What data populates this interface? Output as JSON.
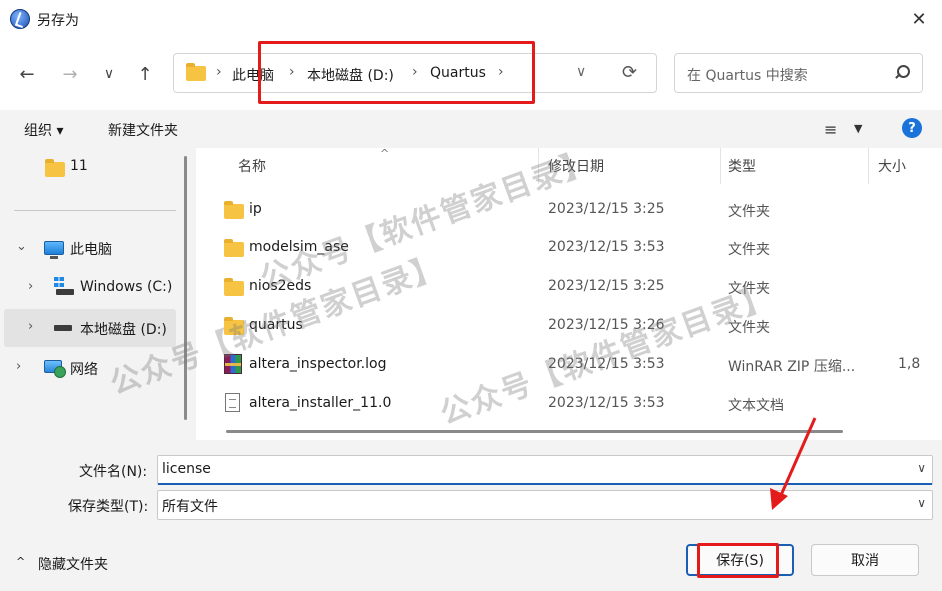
{
  "window": {
    "title": "另存为",
    "close_glyph": "✕"
  },
  "nav": {
    "back_glyph": "←",
    "forward_glyph": "→",
    "recent_glyph": "∨",
    "up_glyph": "↑"
  },
  "address": {
    "crumbs": [
      "此电脑",
      "本地磁盘 (D:)",
      "Quartus"
    ],
    "sep_glyph": "›",
    "dropdown_glyph": "∨",
    "refresh_glyph": "⟳"
  },
  "search": {
    "placeholder": "在 Quartus 中搜索"
  },
  "toolbar": {
    "organize_label": "组织 ▾",
    "new_folder_label": "新建文件夹",
    "view_glyph": "≡",
    "view_arrow_glyph": "▼",
    "help_glyph": "?"
  },
  "sidebar": {
    "items": [
      {
        "label": "11",
        "icon": "folder-icon"
      },
      {
        "label": "此电脑",
        "icon": "pc-icon"
      },
      {
        "label": "Windows (C:)",
        "icon": "windows-drive-icon"
      },
      {
        "label": "本地磁盘 (D:)",
        "icon": "drive-icon"
      },
      {
        "label": "网络",
        "icon": "network-icon"
      }
    ],
    "chevron_down": "⌄",
    "chevron_right": "›"
  },
  "columns": {
    "name": "名称",
    "date": "修改日期",
    "type": "类型",
    "size": "大小",
    "sort_glyph": "^"
  },
  "files": [
    {
      "name": "ip",
      "date": "2023/12/15 3:25",
      "type": "文件夹",
      "size": "",
      "icon": "folder-icon"
    },
    {
      "name": "modelsim_ase",
      "date": "2023/12/15 3:53",
      "type": "文件夹",
      "size": "",
      "icon": "folder-icon"
    },
    {
      "name": "nios2eds",
      "date": "2023/12/15 3:25",
      "type": "文件夹",
      "size": "",
      "icon": "folder-icon"
    },
    {
      "name": "quartus",
      "date": "2023/12/15 3:26",
      "type": "文件夹",
      "size": "",
      "icon": "folder-icon"
    },
    {
      "name": "altera_inspector.log",
      "date": "2023/12/15 3:53",
      "type": "WinRAR ZIP 压缩...",
      "size": "1,8",
      "icon": "winrar-icon"
    },
    {
      "name": "altera_installer_11.0",
      "date": "2023/12/15 3:53",
      "type": "文本文档",
      "size": "",
      "icon": "text-file-icon"
    }
  ],
  "form": {
    "filename_label": "文件名(N):",
    "filename_value": "license",
    "filetype_label": "保存类型(T):",
    "filetype_value": "所有文件",
    "dropdown_glyph": "∨"
  },
  "footer": {
    "hide_folders_label": "隐藏文件夹",
    "hide_folders_glyph": "^",
    "save_label": "保存(S)",
    "cancel_label": "取消"
  },
  "watermark": {
    "text": "公众号【软件管家目录】"
  },
  "colors": {
    "annotation_red": "#e41b1b",
    "accent_blue": "#1a5fb4",
    "folder_yellow": "#f6c343"
  }
}
